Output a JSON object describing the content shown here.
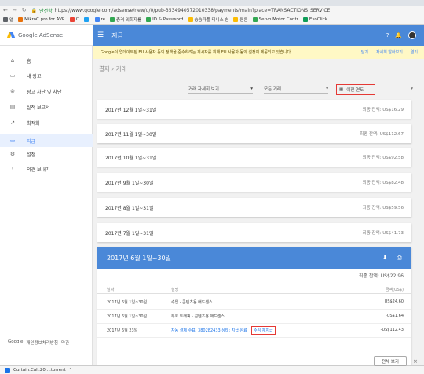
{
  "browser": {
    "url": "https://www.google.com/adsense/new/u/0/pub-3534940572010338/payments/main?place=TRANSACTIONS_SERVICE",
    "secure_label": "안전함",
    "back": "←",
    "forward": "→",
    "reload": "↻",
    "bookmarks": [
      {
        "label": "앱",
        "color": "#5f6368"
      },
      {
        "label": "MikroC pro for AVR",
        "color": "#e8710a"
      },
      {
        "label": "C",
        "color": "#ea4335"
      },
      {
        "label": "",
        "color": "#1da1f2"
      },
      {
        "label": "re",
        "color": "#4285f4"
      },
      {
        "label": "충격 의회자를",
        "color": "#34a853"
      },
      {
        "label": "ID & Password",
        "color": "#34a853"
      },
      {
        "label": "숭숭파플 테니스 쉼",
        "color": "#fbbc04"
      },
      {
        "label": "원룸",
        "color": "#fbbc04"
      },
      {
        "label": "Servo Motor Contr",
        "color": "#34a853"
      },
      {
        "label": "ExoClick",
        "color": "#0f9d58"
      }
    ]
  },
  "app": {
    "logo_text": "Google AdSense",
    "title": "지급",
    "menu_icon": "☰",
    "help_icon": "?",
    "bell_icon": "🔔"
  },
  "sidebar": {
    "items": [
      {
        "label": "홈",
        "icon": "⌂",
        "active": false
      },
      {
        "label": "내 광고",
        "icon": "▭",
        "active": false
      },
      {
        "label": "광고 차단 및 차단",
        "icon": "⊘",
        "active": false
      },
      {
        "label": "실적 보고서",
        "icon": "▤",
        "active": false
      },
      {
        "label": "최적화",
        "icon": "↗",
        "active": false
      },
      {
        "label": "지급",
        "icon": "▭",
        "active": true
      },
      {
        "label": "설정",
        "icon": "⚙",
        "active": false
      },
      {
        "label": "의견 보내기",
        "icon": "!",
        "active": false
      }
    ],
    "footer": [
      "Google",
      "개인정보처리방침",
      "약관"
    ]
  },
  "notice": {
    "text": "Google이 업데이트된 EU 사용자 동의 정책을 준수하려는 게시자를 위해 EU 사용자 동의 설정이 제공되고 있습니다.",
    "actions": [
      "닫기",
      "자세히 알아보기",
      "열기"
    ]
  },
  "breadcrumb": "결제 › 거래",
  "filters": {
    "view": "거래 자세히 보기",
    "type": "모든 거래",
    "prev_year": "이전 연도",
    "caret": "▾"
  },
  "months": [
    {
      "label": "2017년 12월 1일~31일",
      "balance": "최종 잔액: US$16.29"
    },
    {
      "label": "2017년 11월 1일~30일",
      "balance": "최종 잔액: US$112.67"
    },
    {
      "label": "2017년 10월 1일~31일",
      "balance": "최종 잔액: US$92.58"
    },
    {
      "label": "2017년 9월 1일~30일",
      "balance": "최종 잔액: US$82.48"
    },
    {
      "label": "2017년 8월 1일~31일",
      "balance": "최종 잔액: US$59.56"
    },
    {
      "label": "2017년 7월 1일~31일",
      "balance": "최종 잔액: US$41.73"
    }
  ],
  "expanded": {
    "title": "2017년 6월 1일~30일",
    "balance": "최종 잔액: US$22.96",
    "download_icon": "⬇",
    "print_icon": "⎙",
    "columns": [
      "날짜",
      "설명",
      "금액(US$)"
    ],
    "rows": [
      {
        "date": "2017년 6월 1일~30일",
        "desc": "수입 - 콘텐츠용 애드센스",
        "extra": "",
        "amount": "US$24.60"
      },
      {
        "date": "2017년 6월 1일~30일",
        "desc": "무효 트래픽 - 콘텐츠용 애드센스",
        "extra": "",
        "amount": "-US$1.64"
      },
      {
        "date": "2017년 6월 23일",
        "desc": "자동 결제 수표: 380282433 상태: 지급 완료",
        "extra": "수익 재지급",
        "amount": "-US$112.43"
      }
    ]
  },
  "downloads": {
    "file": "Curtain.Call.20....torrent",
    "show_all": "전체 보기",
    "close": "×"
  }
}
